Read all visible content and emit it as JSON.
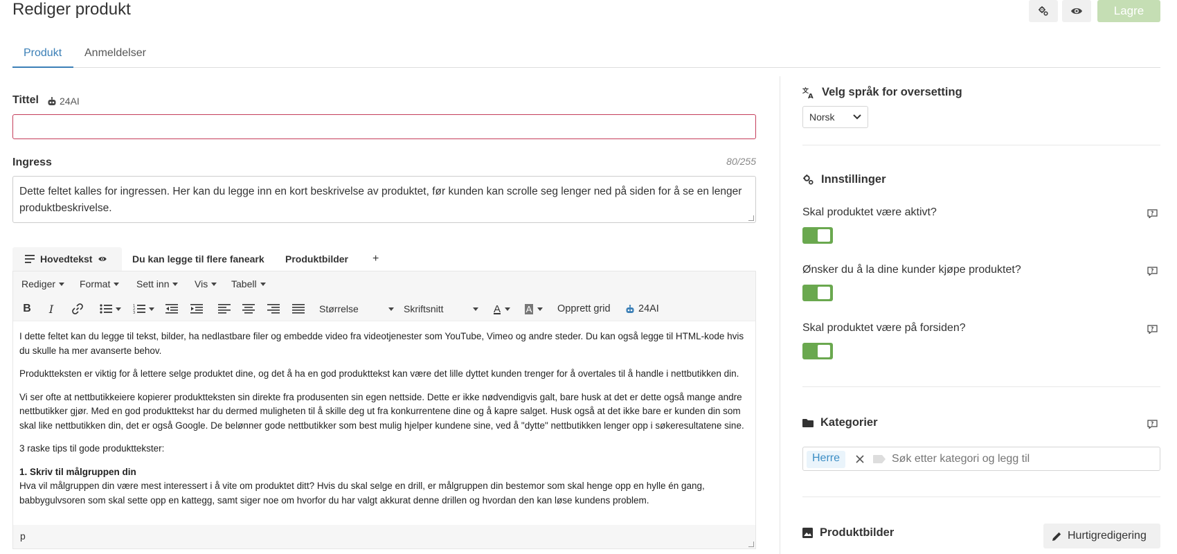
{
  "header": {
    "title": "Rediger produkt",
    "save_label": "Lagre"
  },
  "tabs": [
    {
      "label": "Produkt",
      "active": true
    },
    {
      "label": "Anmeldelser",
      "active": false
    }
  ],
  "form": {
    "title_label": "Tittel",
    "ai_label": "24AI",
    "title_value": "",
    "ingress_label": "Ingress",
    "ingress_counter": "80/255",
    "ingress_value": "Dette feltet kalles for ingressen. Her kan du legge inn en kort beskrivelse av produktet, før kunden kan scrolle seg lenger ned på siden for å se en lenger produktbeskrivelse."
  },
  "editor": {
    "tabs": [
      {
        "label": "Hovedtekst",
        "active": true
      },
      {
        "label": "Du kan legge til flere faneark",
        "active": false
      },
      {
        "label": "Produktbilder",
        "active": false
      },
      {
        "label": "+",
        "active": false
      }
    ],
    "menu": [
      "Rediger",
      "Format",
      "Sett inn",
      "Vis",
      "Tabell"
    ],
    "toolbar": {
      "size_label": "Størrelse",
      "font_label": "Skriftsnitt",
      "grid_label": "Opprett grid",
      "ai_label": "24AI"
    },
    "content": {
      "p1": "I dette feltet kan du legge til tekst, bilder, ha nedlastbare filer og embedde video fra videotjenester som YouTube, Vimeo og andre steder. Du kan også legge til HTML-kode hvis du skulle ha mer avanserte behov.",
      "p2": "Produktteksten er viktig for å lettere selge produktet dine, og det å ha en god produkttekst kan være det lille dyttet kunden trenger for å overtales til å handle i nettbutikken din.",
      "p3": "Vi ser ofte at nettbutikkeiere kopierer produktteksten sin direkte fra produsenten sin egen nettside. Dette er ikke nødvendigvis galt, bare husk at det er dette også mange andre nettbutikker gjør. Med en god produkttekst har du dermed muligheten til å skille deg ut fra konkurrentene dine og å kapre salget. Husk også at det ikke bare er kunden din som skal like nettbutikken din, det er også Google. De belønner gode nettbutikker som best mulig hjelper kundene sine, ved å \"dytte\" nettbutikken lenger opp i søkeresultatene sine.",
      "p4": "3 raske tips til gode produkttekster:",
      "h1": "1. Skriv til målgruppen din",
      "p5": "Hva vil målgruppen din være mest interessert i å vite om produktet ditt? Hvis du skal selge en drill, er målgruppen din bestemor som skal henge opp en hylle én gang, babbygulvsoren som skal sette opp en kattegg, samt siger noe om hvorfor du har valgt akkurat denne drillen og hvordan den kan løse kundens problem."
    },
    "status_path": "p"
  },
  "sidebar": {
    "language": {
      "title": "Velg språk for oversetting",
      "selected": "Norsk"
    },
    "settings": {
      "title": "Innstillinger",
      "items": [
        {
          "question": "Skal produktet være aktivt?",
          "on": true
        },
        {
          "question": "Ønsker du å la dine kunder kjøpe produktet?",
          "on": true
        },
        {
          "question": "Skal produktet være på forsiden?",
          "on": true
        }
      ]
    },
    "categories": {
      "title": "Kategorier",
      "chip": "Herre",
      "placeholder": "Søk etter kategori og legg til"
    },
    "images": {
      "title": "Produktbilder",
      "quick_edit": "Hurtigredigering"
    }
  },
  "colors": {
    "accent": "#3b7fb6",
    "toggle_on": "#6aa84f",
    "save_disabled": "#c5deb4",
    "error_border": "#c43c5a"
  }
}
